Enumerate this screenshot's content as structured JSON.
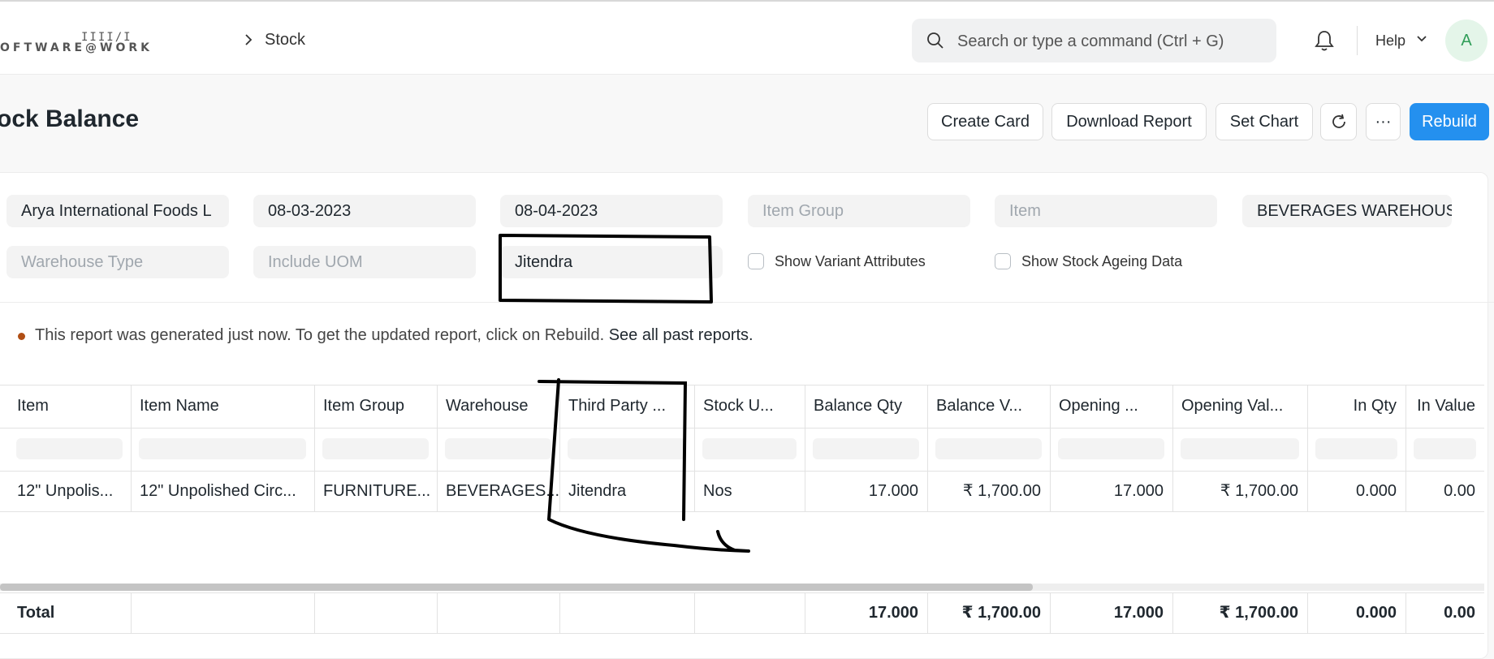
{
  "navbar": {
    "logo_bars": "IIII/I",
    "logo_text": "OFTWARE@WORK",
    "breadcrumb": "Stock",
    "search_placeholder": "Search or type a command (Ctrl + G)",
    "help_label": "Help",
    "avatar_initial": "A"
  },
  "page": {
    "title": "tock Balance",
    "buttons": {
      "create_card": "Create Card",
      "download_report": "Download Report",
      "set_chart": "Set Chart",
      "refresh_icon": "refresh-icon",
      "more": "···",
      "rebuild": "Rebuild"
    }
  },
  "filters": {
    "company": "Arya International Foods L",
    "from_date": "08-03-2023",
    "to_date": "08-04-2023",
    "item_group_placeholder": "Item Group",
    "item_placeholder": "Item",
    "warehouse": "BEVERAGES WAREHOUSE",
    "warehouse_type_placeholder": "Warehouse Type",
    "include_uom_placeholder": "Include UOM",
    "third_party": "Jitendra",
    "show_variant_attributes": "Show Variant Attributes",
    "show_stock_ageing": "Show Stock Ageing Data"
  },
  "notice": {
    "text": "This report was generated just now. To get the updated report, click on Rebuild.",
    "link": "See all past reports."
  },
  "table": {
    "columns": [
      "Item",
      "Item Name",
      "Item Group",
      "Warehouse",
      "Third Party ...",
      "Stock U...",
      "Balance Qty",
      "Balance V...",
      "Opening ...",
      "Opening Val...",
      "In Qty",
      "In Value"
    ],
    "rows": [
      [
        "12\" Unpolis...",
        "12\" Unpolished Circ...",
        "FURNITURE...",
        "BEVERAGES...",
        "Jitendra",
        "Nos",
        "17.000",
        "₹ 1,700.00",
        "17.000",
        "₹ 1,700.00",
        "0.000",
        "0.00"
      ]
    ],
    "total": [
      "Total",
      "",
      "",
      "",
      "",
      "",
      "17.000",
      "₹ 1,700.00",
      "17.000",
      "₹ 1,700.00",
      "0.000",
      "0.00"
    ]
  },
  "colors": {
    "primary": "#2490ef",
    "avatar_bg": "#e4f5e9",
    "avatar_fg": "#2f9d58",
    "notice_dot": "#b04e14"
  }
}
